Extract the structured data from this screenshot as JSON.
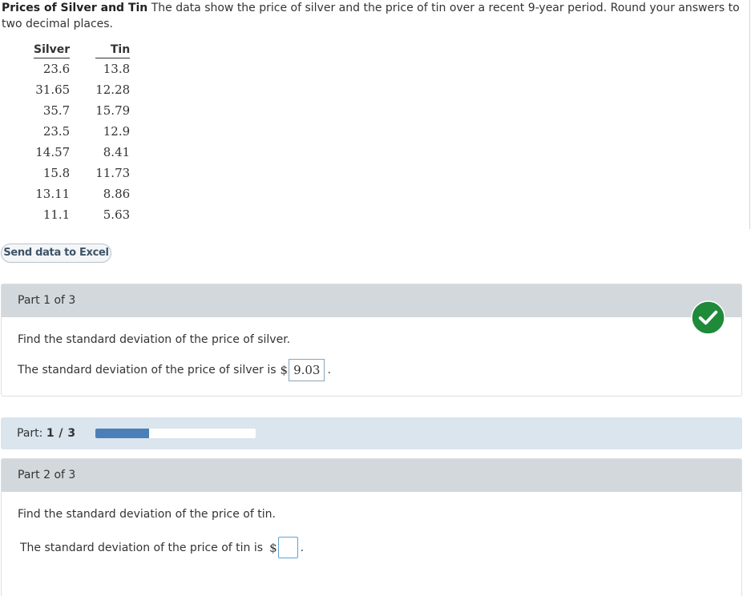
{
  "intro": {
    "title": "Prices of Silver and Tin",
    "text": " The data show the price of silver and the price of tin over a recent 9-year period. Round your answers to two decimal places."
  },
  "table": {
    "headers": [
      "Silver",
      "Tin"
    ],
    "rows": [
      [
        "23.6",
        "13.8"
      ],
      [
        "31.65",
        "12.28"
      ],
      [
        "35.7",
        "15.79"
      ],
      [
        "23.5",
        "12.9"
      ],
      [
        "14.57",
        "8.41"
      ],
      [
        "15.8",
        "11.73"
      ],
      [
        "13.11",
        "8.86"
      ],
      [
        "11.1",
        "5.63"
      ]
    ]
  },
  "excel_button": {
    "label": "Send data to Excel"
  },
  "part1": {
    "header": "Part 1 of 3",
    "question": "Find the standard deviation of the price of silver.",
    "answer_prefix": "The standard deviation of the price of silver is",
    "currency": "$",
    "answer_value": "9.03",
    "suffix": ".",
    "status_icon": "check-circle-icon",
    "status_color": "#1f8a3a"
  },
  "progress": {
    "label": "Part:",
    "count": "1 / 3",
    "fraction": 0.333,
    "fill_color": "#4b7fb8"
  },
  "part2": {
    "header": "Part 2 of 3",
    "question": "Find the standard deviation of the price of tin.",
    "answer_prefix": "The standard deviation of the price of tin is",
    "currency": "$",
    "answer_value": "",
    "suffix": "."
  }
}
